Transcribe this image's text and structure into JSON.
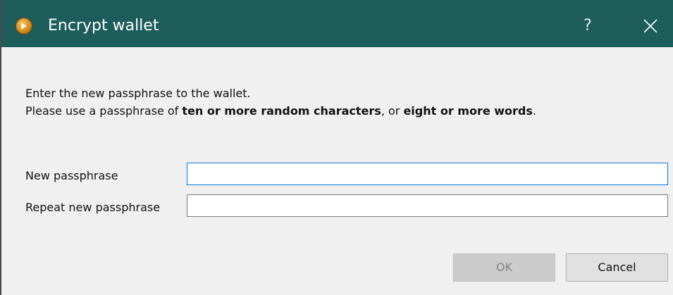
{
  "window": {
    "title": "Encrypt wallet",
    "help_label": "?",
    "icon": "wallet-coin-icon",
    "close_icon": "close-icon",
    "titlebar_color": "#1d5d5b"
  },
  "message": {
    "line1": "Enter the new passphrase to the wallet.",
    "line2_prefix": "Please use a passphrase of ",
    "line2_bold1": "ten or more random characters",
    "line2_middle": ", or ",
    "line2_bold2": "eight or more words",
    "line2_suffix": "."
  },
  "form": {
    "new_passphrase_label": "New passphrase",
    "new_passphrase_value": "",
    "repeat_passphrase_label": "Repeat new passphrase",
    "repeat_passphrase_value": ""
  },
  "buttons": {
    "ok_label": "OK",
    "ok_enabled": false,
    "cancel_label": "Cancel"
  }
}
